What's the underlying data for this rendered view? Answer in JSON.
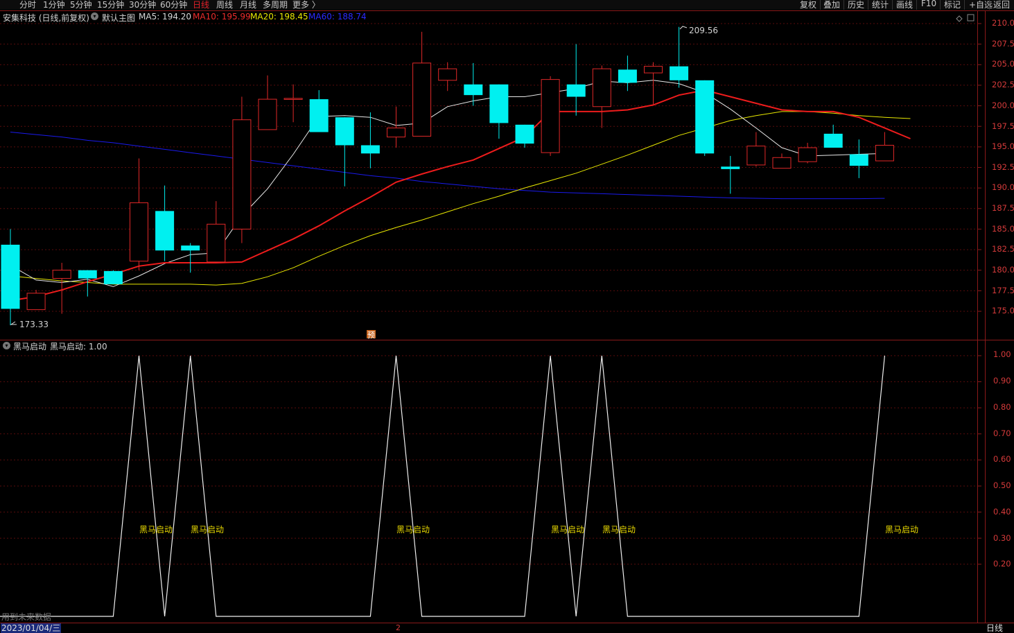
{
  "toolbar": {
    "timeframes": [
      "分时",
      "1分钟",
      "5分钟",
      "15分钟",
      "30分钟",
      "60分钟",
      "日线",
      "周线",
      "月线",
      "多周期",
      "更多 〉"
    ],
    "active_timeframe": "日线",
    "tools": [
      "复权",
      "叠加",
      "历史",
      "统计",
      "画线",
      "F10",
      "标记",
      "+自选",
      "返回"
    ]
  },
  "main_header": {
    "stock": "安集科技 (日线,前复权)",
    "template": "默认主图",
    "ma5": "MA5: 194.20",
    "ma10": "MA10: 195.99",
    "ma20": "MA20: 198.45",
    "ma60": "MA60: 188.74"
  },
  "sub_header": {
    "indicator": "黑马启动",
    "value": "黑马启动: 1.00"
  },
  "annotations": {
    "high": "209.56",
    "low": "173.33",
    "forecast_badge": "预",
    "future_data_note": "用到未来数据",
    "signal_label": "黑马启动"
  },
  "status": {
    "date": "2023/01/04/三",
    "period": "日线",
    "marker": "2"
  },
  "colors": {
    "up": "#e02828",
    "down": "#00f0f0",
    "ma5": "#e8e8e8",
    "ma10": "#ee1c1c",
    "ma20": "#e8e800",
    "ma60": "#1a1aee",
    "axis": "#8b1a1a"
  },
  "chart_data": [
    {
      "type": "candlestick",
      "title": "安集科技 (日线,前复权)",
      "y_axis_ticks": [
        "210.0",
        "207.5",
        "205.0",
        "202.5",
        "200.0",
        "197.5",
        "195.0",
        "192.5",
        "190.0",
        "187.5",
        "185.0",
        "182.5",
        "180.0",
        "177.5",
        "175.0"
      ],
      "ylim": [
        174,
        211
      ],
      "candles": [
        {
          "o": 183.1,
          "h": 185.0,
          "l": 173.3,
          "c": 175.3
        },
        {
          "o": 175.2,
          "h": 177.6,
          "l": 175.2,
          "c": 177.2
        },
        {
          "o": 179.0,
          "h": 180.9,
          "l": 174.7,
          "c": 180.0
        },
        {
          "o": 180.0,
          "h": 180.0,
          "l": 176.8,
          "c": 179.0
        },
        {
          "o": 179.9,
          "h": 180.0,
          "l": 178.3,
          "c": 178.3
        },
        {
          "o": 181.1,
          "h": 193.6,
          "l": 180.0,
          "c": 188.2
        },
        {
          "o": 187.2,
          "h": 190.3,
          "l": 181.1,
          "c": 182.4
        },
        {
          "o": 183.0,
          "h": 183.3,
          "l": 179.7,
          "c": 182.4
        },
        {
          "o": 181.0,
          "h": 188.4,
          "l": 180.9,
          "c": 185.6
        },
        {
          "o": 185.0,
          "h": 201.1,
          "l": 183.3,
          "c": 198.3
        },
        {
          "o": 197.1,
          "h": 203.7,
          "l": 197.1,
          "c": 200.8
        },
        {
          "o": 200.9,
          "h": 202.6,
          "l": 198.0,
          "c": 200.9
        },
        {
          "o": 200.8,
          "h": 201.9,
          "l": 196.8,
          "c": 196.8
        },
        {
          "o": 198.6,
          "h": 198.6,
          "l": 190.2,
          "c": 195.2
        },
        {
          "o": 195.2,
          "h": 199.2,
          "l": 192.4,
          "c": 194.2
        },
        {
          "o": 196.2,
          "h": 199.9,
          "l": 194.9,
          "c": 197.3
        },
        {
          "o": 196.3,
          "h": 209.0,
          "l": 196.3,
          "c": 205.2
        },
        {
          "o": 203.1,
          "h": 205.3,
          "l": 201.8,
          "c": 204.5
        },
        {
          "o": 202.6,
          "h": 205.2,
          "l": 200.0,
          "c": 201.3
        },
        {
          "o": 202.6,
          "h": 202.6,
          "l": 196.0,
          "c": 197.9
        },
        {
          "o": 197.7,
          "h": 197.7,
          "l": 194.9,
          "c": 195.4
        },
        {
          "o": 194.3,
          "h": 203.6,
          "l": 193.9,
          "c": 203.2
        },
        {
          "o": 202.6,
          "h": 207.5,
          "l": 198.8,
          "c": 201.1
        },
        {
          "o": 199.9,
          "h": 204.9,
          "l": 197.3,
          "c": 204.5
        },
        {
          "o": 204.4,
          "h": 206.1,
          "l": 201.8,
          "c": 202.8
        },
        {
          "o": 204.0,
          "h": 205.3,
          "l": 200.2,
          "c": 204.8
        },
        {
          "o": 204.8,
          "h": 209.6,
          "l": 202.2,
          "c": 203.1
        },
        {
          "o": 203.1,
          "h": 203.1,
          "l": 193.9,
          "c": 194.2
        },
        {
          "o": 192.6,
          "h": 193.9,
          "l": 189.3,
          "c": 192.3
        },
        {
          "o": 192.8,
          "h": 196.8,
          "l": 192.6,
          "c": 195.1
        },
        {
          "o": 192.4,
          "h": 194.2,
          "l": 192.4,
          "c": 193.7
        },
        {
          "o": 193.2,
          "h": 195.5,
          "l": 193.0,
          "c": 194.9
        },
        {
          "o": 196.6,
          "h": 197.7,
          "l": 194.9,
          "c": 194.9
        },
        {
          "o": 194.1,
          "h": 195.9,
          "l": 191.2,
          "c": 192.7
        },
        {
          "o": 193.3,
          "h": 196.8,
          "l": 193.3,
          "c": 195.2
        }
      ],
      "ma5": [
        180.6,
        178.8,
        178.5,
        178.9,
        178.0,
        179.3,
        180.8,
        181.9,
        182.1,
        186.6,
        189.9,
        194.1,
        198.7,
        198.8,
        198.6,
        197.6,
        197.9,
        199.9,
        200.6,
        201.1,
        201.1,
        201.6,
        202.1,
        203.0,
        202.8,
        203.1,
        202.7,
        201.6,
        199.6,
        197.3,
        194.9,
        193.9,
        194.0,
        194.1,
        194.2
      ],
      "ma10": [
        176.3,
        176.8,
        177.6,
        178.6,
        179.5,
        180.5,
        180.9,
        180.9,
        180.9,
        181.0,
        182.4,
        183.8,
        185.4,
        187.2,
        188.9,
        190.7,
        191.7,
        192.6,
        193.4,
        194.8,
        196.2,
        199.3,
        199.3,
        199.3,
        199.5,
        200.1,
        201.3,
        201.9,
        201.1,
        200.3,
        199.5,
        199.3,
        199.3,
        198.6,
        197.3,
        196.0
      ],
      "ma20": [
        179.3,
        179.0,
        178.7,
        178.5,
        178.3,
        178.3,
        178.3,
        178.3,
        178.2,
        178.4,
        179.2,
        180.3,
        181.7,
        183.0,
        184.2,
        185.2,
        186.1,
        187.1,
        188.1,
        189.0,
        190.0,
        190.9,
        191.8,
        192.9,
        194.0,
        195.2,
        196.4,
        197.3,
        198.2,
        198.8,
        199.3,
        199.3,
        199.1,
        198.8,
        198.6,
        198.45
      ],
      "ma60": [
        196.8,
        196.5,
        196.2,
        195.8,
        195.5,
        195.1,
        194.7,
        194.3,
        193.9,
        193.5,
        193.1,
        192.7,
        192.3,
        191.9,
        191.5,
        191.2,
        190.8,
        190.5,
        190.2,
        189.9,
        189.7,
        189.5,
        189.4,
        189.3,
        189.2,
        189.1,
        189.0,
        188.9,
        188.8,
        188.75,
        188.7,
        188.7,
        188.7,
        188.7,
        188.74
      ]
    },
    {
      "type": "line",
      "title": "黑马启动",
      "y_axis_ticks": [
        "1.00",
        "0.90",
        "0.80",
        "0.70",
        "0.60",
        "0.50",
        "0.40",
        "0.30",
        "0.20"
      ],
      "ylim": [
        0,
        1.0
      ],
      "values": [
        0,
        0,
        0,
        0,
        0,
        1,
        0,
        1,
        0,
        0,
        0,
        0,
        0,
        0,
        0,
        1,
        0,
        0,
        0,
        0,
        0,
        1,
        0,
        1,
        0,
        0,
        0,
        0,
        0,
        0,
        0,
        0,
        0,
        0,
        1
      ],
      "signal_indices": [
        5,
        7,
        15,
        21,
        23,
        34
      ]
    }
  ]
}
